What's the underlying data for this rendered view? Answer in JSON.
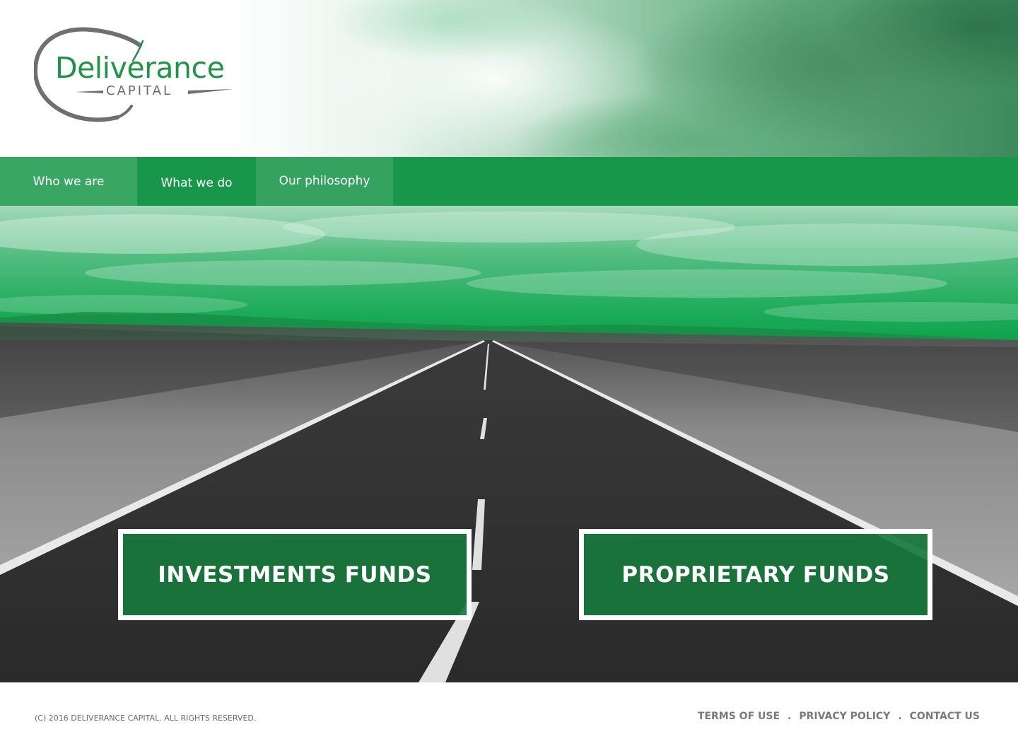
{
  "brand": {
    "name": "Deliverance",
    "subname": "CAPITAL"
  },
  "nav": {
    "items": [
      {
        "label": "Who we are"
      },
      {
        "label": "What we do"
      },
      {
        "label": "Our philosophy"
      }
    ]
  },
  "hero": {
    "buttons": [
      {
        "label": "INVESTMENTS FUNDS"
      },
      {
        "label": "PROPRIETARY FUNDS"
      }
    ]
  },
  "footer": {
    "copyright": "(C) 2016 DELIVERANCE CAPITAL. ALL RIGHTS RESERVED.",
    "links": [
      {
        "label": "TERMS OF USE"
      },
      {
        "label": "PRIVACY POLICY"
      },
      {
        "label": "CONTACT US"
      }
    ],
    "separator": "."
  },
  "colors": {
    "brand_green": "#189649",
    "logo_green": "#1e9447",
    "logo_grey": "#6a6a6a",
    "footer_text": "#7a7a7a"
  }
}
